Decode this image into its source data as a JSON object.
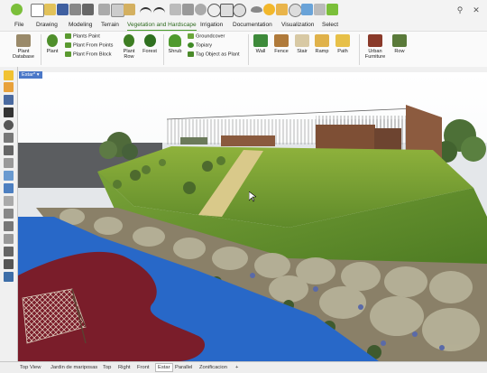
{
  "main_tabs": [
    {
      "label": "File"
    },
    {
      "label": "Drawing"
    },
    {
      "label": "Modeling"
    },
    {
      "label": "Terrain"
    },
    {
      "label": "Vegetation and Hardscape"
    },
    {
      "label": "Irrigation"
    },
    {
      "label": "Documentation"
    },
    {
      "label": "Visualization"
    },
    {
      "label": "Select"
    }
  ],
  "ribbon": {
    "plant_database": "Plant\nDatabase",
    "plant": "Plant",
    "plants_paint": "Plants Paint",
    "plant_from_points": "Plant From Points",
    "plant_from_block": "Plant From Block",
    "plant_row": "Plant\nRow",
    "forest": "Forest",
    "shrub": "Shrub",
    "groundcover": "Groundcover",
    "topiary": "Topiary",
    "tag_object_as_plant": "Tag Object as Plant",
    "wall": "Wall",
    "fence": "Fence",
    "stair": "Stair",
    "ramp": "Ramp",
    "path": "Path",
    "urban_furniture": "Urban\nFurniture",
    "row": "Row"
  },
  "viewport": {
    "label": "Estar*"
  },
  "view_tabs": [
    {
      "label": "Top View"
    },
    {
      "label": "Jardin de mariposas"
    },
    {
      "label": "Top"
    },
    {
      "label": "Right"
    },
    {
      "label": "Front"
    },
    {
      "label": "Estar"
    },
    {
      "label": "Parallel"
    },
    {
      "label": "Zonificacion"
    },
    {
      "label": "+"
    }
  ],
  "active_view_tab": "Estar",
  "colors": {
    "accent": "#4aa02c",
    "viewport_label": "#4b78c8"
  }
}
